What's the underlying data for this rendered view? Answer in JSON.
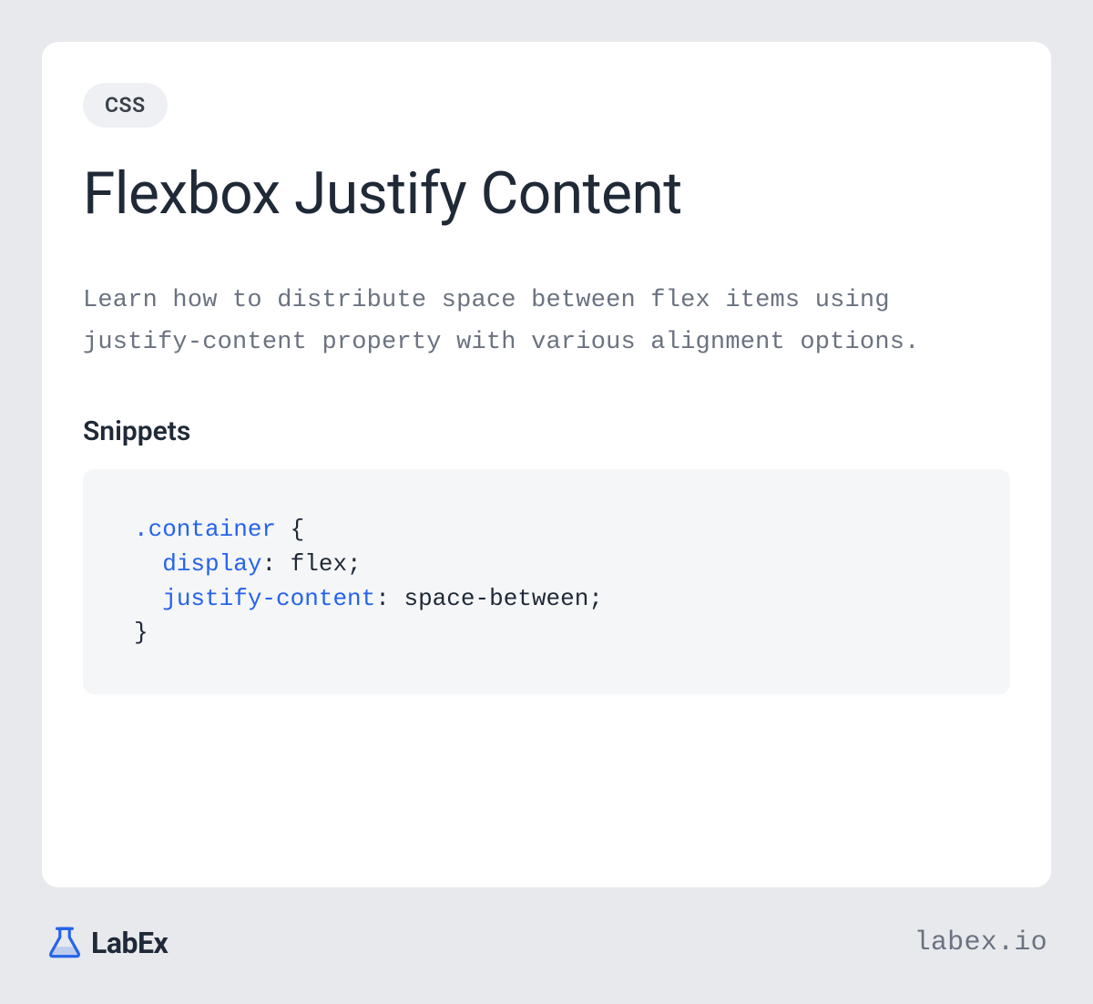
{
  "tag": "CSS",
  "title": "Flexbox Justify Content",
  "description": "Learn how to distribute space between flex items using justify-content property with various alignment options.",
  "snippets_heading": "Snippets",
  "code": {
    "selector": ".container",
    "open_brace": " {",
    "prop1_name": "display",
    "prop1_value": ": flex;",
    "prop2_name": "justify-content",
    "prop2_value": ": space-between;",
    "close_brace": "}"
  },
  "footer": {
    "logo_text": "LabEx",
    "url": "labex.io"
  }
}
